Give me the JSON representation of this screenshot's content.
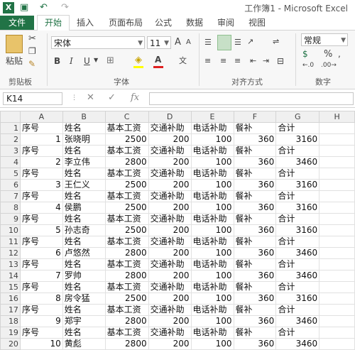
{
  "window": {
    "title": "工作簿1 - Microsoft Excel",
    "logo": "X",
    "undo": "↶",
    "redo": "↷"
  },
  "tabs": [
    "文件",
    "开始",
    "插入",
    "页面布局",
    "公式",
    "数据",
    "审阅",
    "视图"
  ],
  "active_tab": "开始",
  "ribbon": {
    "clipboard": {
      "paste": "粘贴",
      "label": "剪贴板"
    },
    "font": {
      "name": "宋体",
      "size": "11",
      "bold": "B",
      "italic": "I",
      "underline": "U",
      "grow": "A",
      "shrink": "A",
      "label": "字体",
      "color_a": "A"
    },
    "align": {
      "label": "对齐方式"
    },
    "number": {
      "format": "常规",
      "label": "数字",
      "percent": "%"
    }
  },
  "formula_bar": {
    "name_box": "K14",
    "cancel": "✕",
    "enter": "✓",
    "fx": "fx",
    "value": ""
  },
  "grid": {
    "columns": [
      "A",
      "B",
      "C",
      "D",
      "E",
      "F",
      "G",
      "H"
    ],
    "rows": [
      {
        "n": "1",
        "cells": [
          "序号",
          "姓名",
          "基本工资",
          "交通补助",
          "电话补助",
          "餐补",
          "合计",
          ""
        ]
      },
      {
        "n": "2",
        "cells": [
          "1",
          "张晓明",
          "2500",
          "200",
          "100",
          "360",
          "3160",
          ""
        ]
      },
      {
        "n": "3",
        "cells": [
          "序号",
          "姓名",
          "基本工资",
          "交通补助",
          "电话补助",
          "餐补",
          "合计",
          ""
        ]
      },
      {
        "n": "4",
        "cells": [
          "2",
          "李立伟",
          "2800",
          "200",
          "100",
          "360",
          "3460",
          ""
        ]
      },
      {
        "n": "5",
        "cells": [
          "序号",
          "姓名",
          "基本工资",
          "交通补助",
          "电话补助",
          "餐补",
          "合计",
          ""
        ]
      },
      {
        "n": "6",
        "cells": [
          "3",
          "王仁义",
          "2500",
          "200",
          "100",
          "360",
          "3160",
          ""
        ]
      },
      {
        "n": "7",
        "cells": [
          "序号",
          "姓名",
          "基本工资",
          "交通补助",
          "电话补助",
          "餐补",
          "合计",
          ""
        ]
      },
      {
        "n": "8",
        "cells": [
          "4",
          "侯鹏",
          "2500",
          "200",
          "100",
          "360",
          "3160",
          ""
        ]
      },
      {
        "n": "9",
        "cells": [
          "序号",
          "姓名",
          "基本工资",
          "交通补助",
          "电话补助",
          "餐补",
          "合计",
          ""
        ]
      },
      {
        "n": "10",
        "cells": [
          "5",
          "孙志奇",
          "2500",
          "200",
          "100",
          "360",
          "3160",
          ""
        ]
      },
      {
        "n": "11",
        "cells": [
          "序号",
          "姓名",
          "基本工资",
          "交通补助",
          "电话补助",
          "餐补",
          "合计",
          ""
        ]
      },
      {
        "n": "12",
        "cells": [
          "6",
          "卢悠然",
          "2800",
          "200",
          "100",
          "360",
          "3460",
          ""
        ]
      },
      {
        "n": "13",
        "cells": [
          "序号",
          "姓名",
          "基本工资",
          "交通补助",
          "电话补助",
          "餐补",
          "合计",
          ""
        ]
      },
      {
        "n": "14",
        "cells": [
          "7",
          "罗帅",
          "2800",
          "200",
          "100",
          "360",
          "3460",
          ""
        ]
      },
      {
        "n": "15",
        "cells": [
          "序号",
          "姓名",
          "基本工资",
          "交通补助",
          "电话补助",
          "餐补",
          "合计",
          ""
        ]
      },
      {
        "n": "16",
        "cells": [
          "8",
          "房令猛",
          "2500",
          "200",
          "100",
          "360",
          "3160",
          ""
        ]
      },
      {
        "n": "17",
        "cells": [
          "序号",
          "姓名",
          "基本工资",
          "交通补助",
          "电话补助",
          "餐补",
          "合计",
          ""
        ]
      },
      {
        "n": "18",
        "cells": [
          "9",
          "郑宇",
          "2800",
          "200",
          "100",
          "360",
          "3460",
          ""
        ]
      },
      {
        "n": "19",
        "cells": [
          "序号",
          "姓名",
          "基本工资",
          "交通补助",
          "电话补助",
          "餐补",
          "合计",
          ""
        ]
      },
      {
        "n": "20",
        "cells": [
          "10",
          "黄彪",
          "2800",
          "200",
          "100",
          "360",
          "3460",
          ""
        ]
      }
    ]
  }
}
